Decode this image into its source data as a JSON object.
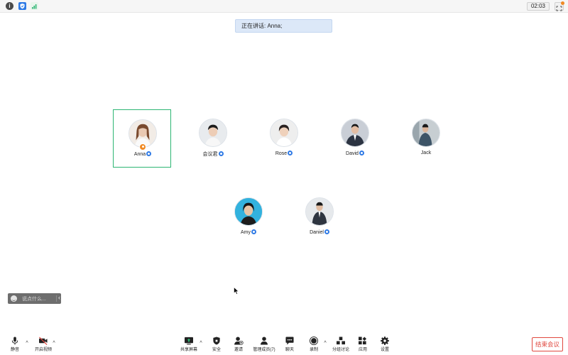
{
  "topbar": {
    "timer": "02:03",
    "icons": [
      "info-icon",
      "shield-icon",
      "signal-icon",
      "expand-icon"
    ]
  },
  "speaking_banner": "正在讲话: Anna;",
  "participants": [
    {
      "name": "Anna",
      "is_host": true,
      "active_speaker": true
    },
    {
      "name": "会议君",
      "is_host": false,
      "active_speaker": false
    },
    {
      "name": "Rose",
      "is_host": false,
      "active_speaker": false
    },
    {
      "name": "David",
      "is_host": false,
      "active_speaker": false
    },
    {
      "name": "Jack",
      "is_host": false,
      "active_speaker": false
    },
    {
      "name": "Amy",
      "is_host": false,
      "active_speaker": false
    },
    {
      "name": "Daniel",
      "is_host": false,
      "active_speaker": false
    }
  ],
  "chat": {
    "placeholder": "说点什么...",
    "collapse": "‹"
  },
  "toolbar": {
    "mute": "静音",
    "video": "开启视频",
    "share": "共享屏幕",
    "security": "安全",
    "invite": "邀请",
    "members": "管理成员(7)",
    "chat": "聊天",
    "record": "录制",
    "breakout": "分组讨论",
    "apps": "应用",
    "settings": "设置",
    "end": "结束会议",
    "caret": "^"
  },
  "colors": {
    "active_border": "#2db673",
    "host_badge": "#f08a24",
    "member_badge": "#2f7ae5",
    "end_button": "#e0483f",
    "banner_bg": "#dce8f8"
  }
}
